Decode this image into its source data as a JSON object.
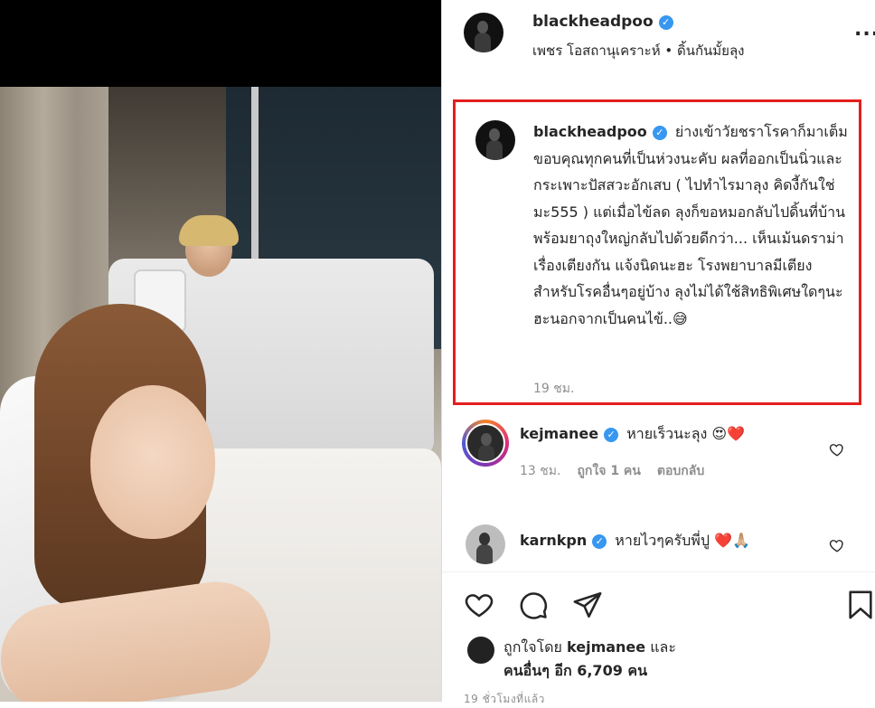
{
  "post": {
    "username": "blackheadpoo",
    "subtitle": "เพชร โอสถานุเคราะห์ • ดิ้นกันมั้ยลุง",
    "more_label": "..."
  },
  "caption": {
    "username": "blackheadpoo",
    "text": "ย่างเข้าวัยชราโรคาก็มาเต็ม ขอบคุณทุกคนที่เป็นห่วงนะคับ ผลที่ออกเป็นนิ่วและกระเพาะปัสสวะอักเสบ ( ไปทำไรมาลุง คิดงี้กันใช่มะ555 ) แต่เมื่อไข้ลด ลุงก็ขอหมอกลับไปดิ้นที่บ้านพร้อมยาถุงใหญ่กลับไปด้วยดีกว่า... เห็นเม้นดราม่าเรื่องเตียงกัน แจ้งนิดนะฮะ โรงพยาบาลมีเตียงสำหรับโรคอื่นๆอยู่บ้าง ลุงไม่ได้ใช้สิทธิพิเศษใดๆนะฮะนอกจากเป็นคนไข้..😅",
    "time": "19 ชม."
  },
  "comments": [
    {
      "username": "kejmanee",
      "text": "หายเร็วนะลุง 😍❤️",
      "time": "13 ชม.",
      "likes": "ถูกใจ 1 คน",
      "reply": "ตอบกลับ"
    },
    {
      "username": "karnkpn",
      "text": "หายไวๆครับพี่ปู ❤️🙏🏼"
    }
  ],
  "likes": {
    "line1_prefix": "ถูกใจโดย",
    "liker": "kejmanee",
    "line1_suffix": "และ",
    "line2": "คนอื่นๆ อีก 6,709 คน"
  },
  "posted": "19 ชั่วโมงที่แล้ว",
  "colors": {
    "verified": "#3897f0",
    "highlight_border": "#e41e1e",
    "heart_red": "#ed4956",
    "muted": "#8e8e8e"
  },
  "icons": [
    "heart-icon",
    "comment-icon",
    "share-icon",
    "bookmark-icon",
    "verified-icon",
    "more-icon"
  ]
}
